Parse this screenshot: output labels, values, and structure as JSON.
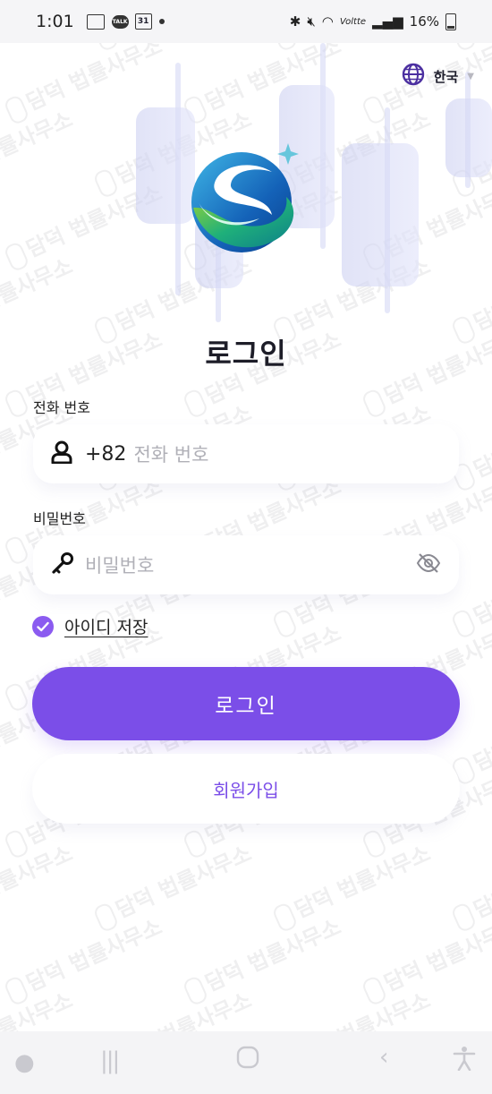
{
  "status_bar": {
    "time": "1:01",
    "talk_badge": "TALK",
    "calendar_day": "31",
    "lte": "Voltte",
    "battery": "16%"
  },
  "language": {
    "label": "한국",
    "icon": "globe-icon"
  },
  "title": "로그인",
  "phone": {
    "label": "전화 번호",
    "country_code": "+82",
    "placeholder": "전화 번호",
    "icon": "person-icon"
  },
  "password": {
    "label": "비밀번호",
    "placeholder": "비밀번호",
    "icon": "key-icon",
    "toggle_icon": "eye-off-icon"
  },
  "remember": {
    "label": "아이디 저장",
    "checked": true
  },
  "buttons": {
    "login": "로그인",
    "signup": "회원가입"
  },
  "watermark": "담덕 법률사무소",
  "colors": {
    "accent": "#7b4ee8",
    "check": "#8b5bf0"
  }
}
